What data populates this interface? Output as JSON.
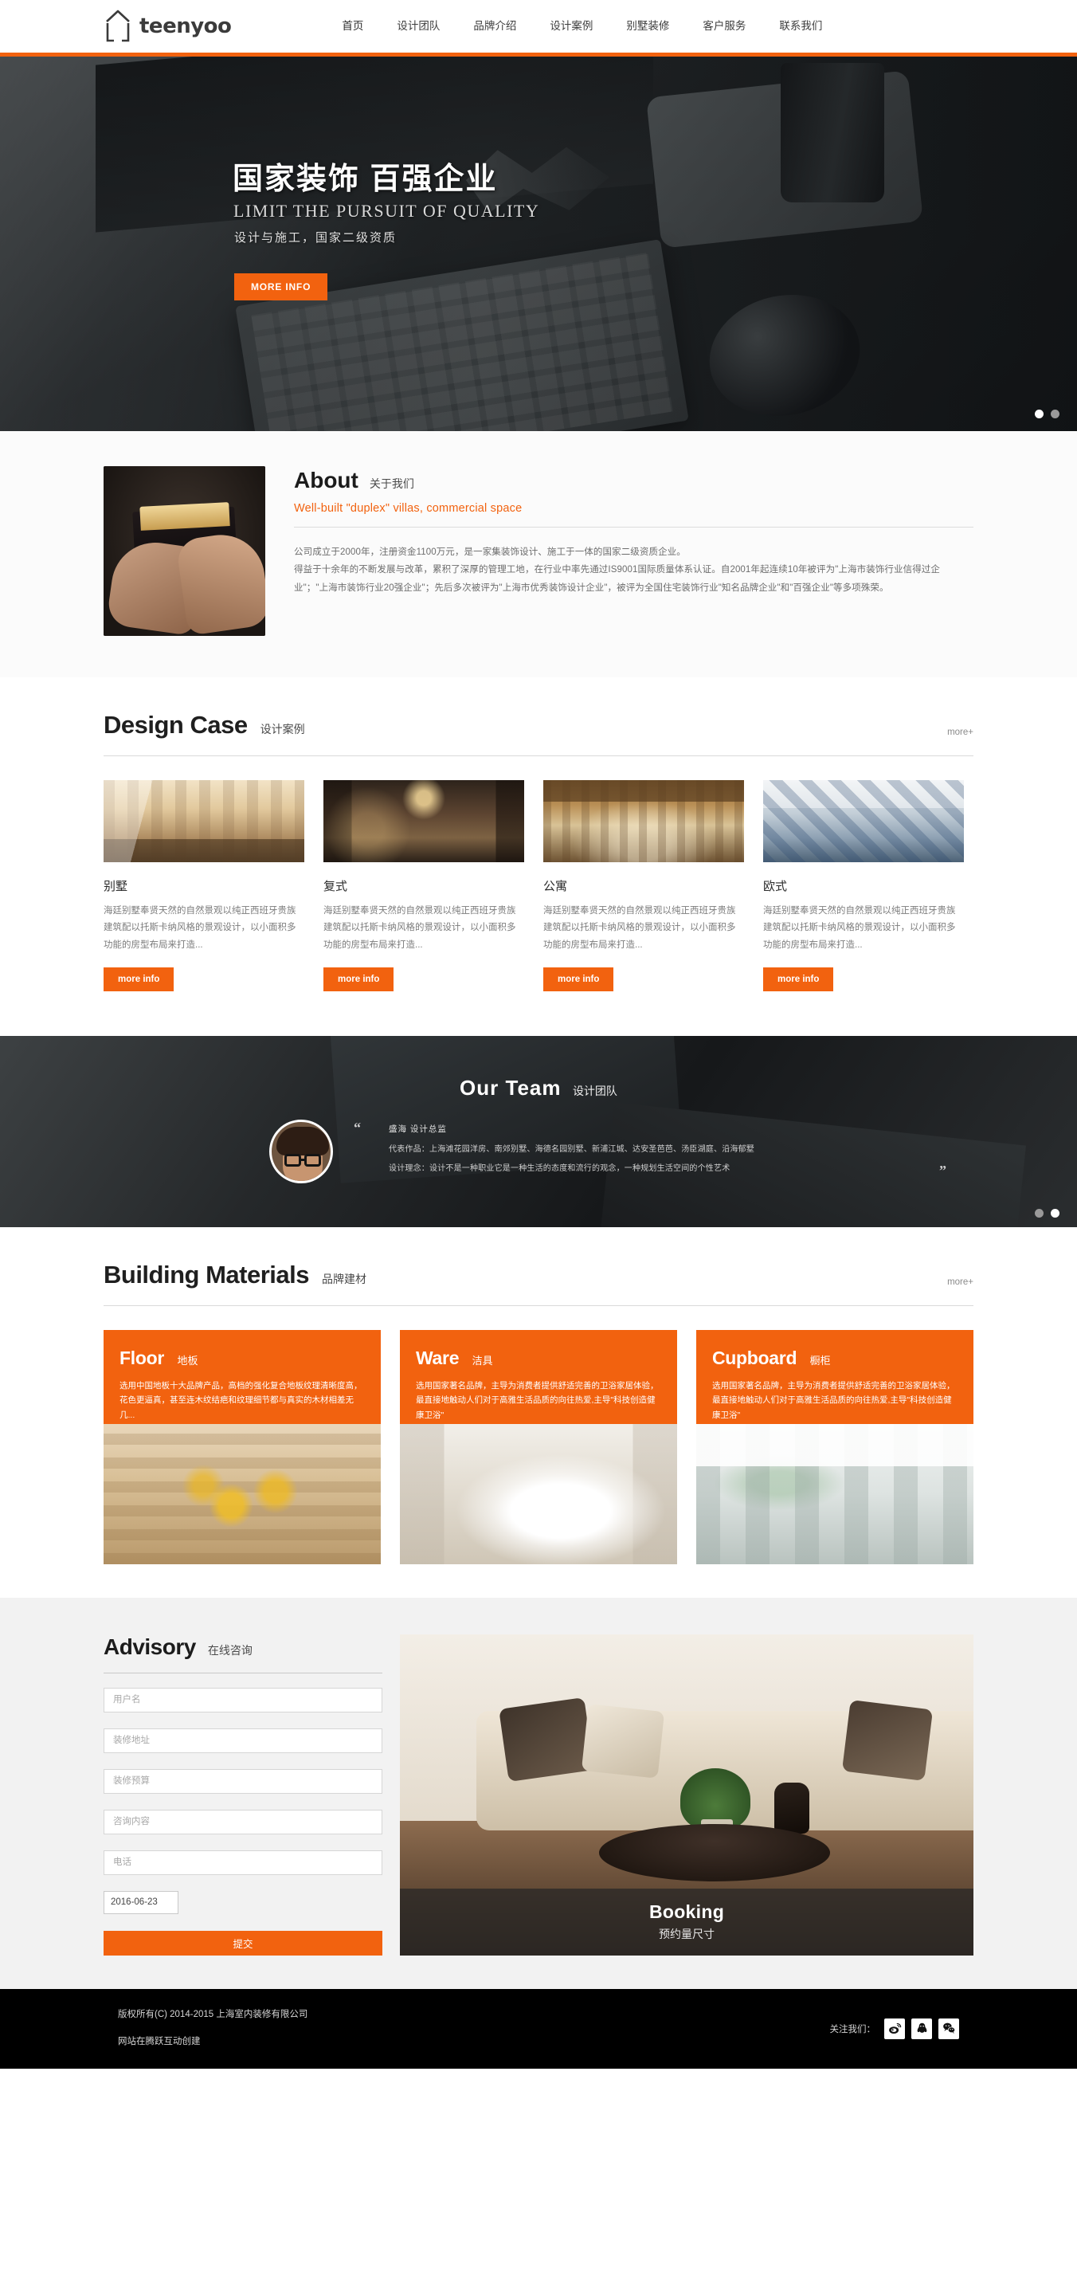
{
  "brand": {
    "name": "teenyoo",
    "logo_icon": "house-icon"
  },
  "nav": {
    "items": [
      {
        "label": "首页"
      },
      {
        "label": "设计团队"
      },
      {
        "label": "品牌介绍"
      },
      {
        "label": "设计案例"
      },
      {
        "label": "别墅装修"
      },
      {
        "label": "客户服务"
      },
      {
        "label": "联系我们"
      }
    ]
  },
  "hero": {
    "title_cn": "国家装饰  百强企业",
    "title_en": "LIMIT THE PURSUIT OF QUALITY",
    "subtitle": "设计与施工，国家二级资质",
    "button": "MORE INFO",
    "dots": [
      {
        "active": true
      },
      {
        "active": false
      }
    ]
  },
  "about": {
    "title_en": "About",
    "title_cn": "关于我们",
    "tagline": "Well-built \"duplex\" villas, commercial space",
    "paragraph1": "公司成立于2000年，注册资金1100万元，是一家集装饰设计、施工于一体的国家二级资质企业。",
    "paragraph2": "得益于十余年的不断发展与改革，累积了深厚的管理工地，在行业中率先通过IS9001国际质量体系认证。自2001年起连续10年被评为\"上海市装饰行业信得过企业\"；\"上海市装饰行业20强企业\"；先后多次被评为\"上海市优秀装饰设计企业\"，被评为全国住宅装饰行业\"知名品牌企业\"和\"百强企业\"等多项殊荣。"
  },
  "design_case": {
    "title_en": "Design Case",
    "title_cn": "设计案例",
    "more": "more+",
    "cards": [
      {
        "title": "别墅",
        "desc": "海廷别墅奉贤天然的自然景观以纯正西班牙贵族建筑配以托斯卡纳风格的景观设计，以小面积多功能的房型布局来打造...",
        "button": "more info"
      },
      {
        "title": "复式",
        "desc": "海廷别墅奉贤天然的自然景观以纯正西班牙贵族建筑配以托斯卡纳风格的景观设计，以小面积多功能的房型布局来打造...",
        "button": "more info"
      },
      {
        "title": "公寓",
        "desc": "海廷别墅奉贤天然的自然景观以纯正西班牙贵族建筑配以托斯卡纳风格的景观设计，以小面积多功能的房型布局来打造...",
        "button": "more info"
      },
      {
        "title": "欧式",
        "desc": "海廷别墅奉贤天然的自然景观以纯正西班牙贵族建筑配以托斯卡纳风格的景观设计，以小面积多功能的房型布局来打造...",
        "button": "more info"
      }
    ]
  },
  "team": {
    "title_en": "Our Team",
    "title_cn": "设计团队",
    "quote_open": "“",
    "quote_close": "”",
    "member_name": "盛海   设计总监",
    "works": "代表作品：上海滩花园洋房、南郊别墅、海德名园别墅、新浦江城、达安圣芭芭、汤臣湖庭、沿海郁墅",
    "philosophy": "设计理念：设计不是一种职业它是一种生活的态度和流行的观念，一种规划生活空间的个性艺术",
    "dots": [
      {
        "active": false
      },
      {
        "active": true
      }
    ]
  },
  "materials": {
    "title_en": "Building Materials",
    "title_cn": "品牌建材",
    "more": "more+",
    "cards": [
      {
        "title_en": "Floor",
        "title_cn": "地板",
        "desc": "选用中国地板十大品牌产品，高档的强化复合地板纹理清晰度高，花色更逼真，甚至连木纹结疤和纹理细节都与真实的木材相差无几..."
      },
      {
        "title_en": "Ware",
        "title_cn": "洁具",
        "desc": "选用国家著名品牌，主导为消费者提供舒适完善的卫浴家居体验，最直接地触动人们对于高雅生活品质的向往热爱,主导\"科技创造健康卫浴\""
      },
      {
        "title_en": "Cupboard",
        "title_cn": "橱柜",
        "desc": "选用国家著名品牌，主导为消费者提供舒适完善的卫浴家居体验，最直接地触动人们对于高雅生活品质的向往热爱,主导\"科技创造健康卫浴\""
      }
    ]
  },
  "advisory": {
    "title_en": "Advisory",
    "title_cn": "在线咨询",
    "fields": [
      {
        "name": "username",
        "placeholder": "用户名",
        "value": ""
      },
      {
        "name": "address",
        "placeholder": "装修地址",
        "value": ""
      },
      {
        "name": "budget",
        "placeholder": "装修预算",
        "value": ""
      },
      {
        "name": "content",
        "placeholder": "咨询内容",
        "value": ""
      },
      {
        "name": "phone",
        "placeholder": "电话",
        "value": ""
      }
    ],
    "date_value": "2016-06-23",
    "submit": "提交",
    "booking_en": "Booking",
    "booking_cn": "预约量尺寸"
  },
  "footer": {
    "copyright": "版权所有(C) 2014-2015 上海室内装修有限公司",
    "built_by": "网站在腾跃互动创建",
    "follow_label": "关注我们：",
    "socials": [
      {
        "name": "weibo-icon",
        "glyph": "☁"
      },
      {
        "name": "qq-icon",
        "glyph": "❁"
      },
      {
        "name": "wechat-icon",
        "glyph": "❤"
      }
    ]
  },
  "colors": {
    "accent": "#f2620f",
    "dark": "#1d1f20",
    "footer": "#000000"
  }
}
